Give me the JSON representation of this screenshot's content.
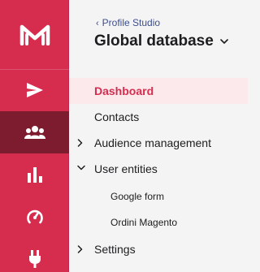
{
  "brand": {
    "accent": "#d62d4f",
    "active_rail": "#7d1c2e",
    "link": "#3d4e8c"
  },
  "rail": {
    "logo": "m-logo",
    "items": [
      {
        "icon": "send-icon",
        "active": false
      },
      {
        "icon": "contacts-icon",
        "active": true
      },
      {
        "icon": "bar-chart-icon",
        "active": false
      },
      {
        "icon": "gauge-icon",
        "active": false
      },
      {
        "icon": "plug-icon",
        "active": false
      }
    ]
  },
  "header": {
    "back_label": "Profile Studio",
    "title": "Global database"
  },
  "nav": {
    "items": [
      {
        "label": "Dashboard",
        "active": true
      },
      {
        "label": "Contacts"
      },
      {
        "label": "Audience management",
        "expandable": "collapsed"
      },
      {
        "label": "User entities",
        "expandable": "expanded"
      },
      {
        "label": "Google form",
        "sub": true
      },
      {
        "label": "Ordini Magento",
        "sub": true
      },
      {
        "label": "Settings",
        "expandable": "collapsed"
      }
    ]
  }
}
